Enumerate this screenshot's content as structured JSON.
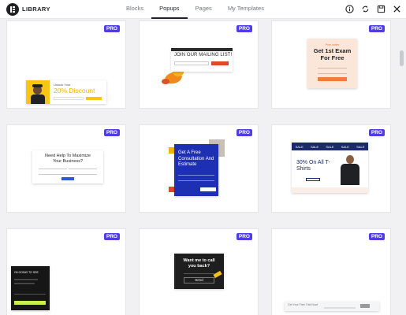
{
  "header": {
    "brand": "LIBRARY",
    "tabs": [
      {
        "label": "Blocks"
      },
      {
        "label": "Popups"
      },
      {
        "label": "Pages"
      },
      {
        "label": "My Templates"
      }
    ],
    "active_tab": "Popups",
    "icons": [
      "info-icon",
      "sync-icon",
      "save-icon",
      "close-icon"
    ]
  },
  "badge_label": "PRO",
  "cards": [
    {
      "title_small": "Unlock Your",
      "title_big": "20% Discount"
    },
    {
      "title": "JOIN OUR MAILING LIST!"
    },
    {
      "kicker": "Prep better",
      "title": "Get 1st Exam For Free"
    },
    {
      "title": "Need Help To Maximize Your Business?"
    },
    {
      "title": "Get A Free Consultation And Estimate"
    },
    {
      "sale_labels": [
        "SALE",
        "SALE",
        "SALE",
        "SALE",
        "SALE"
      ],
      "title": "30% On All T-Shirts"
    },
    {
      "title": "I'M GOING TO SEE"
    },
    {
      "title": "Want me to call you back?",
      "button": "Send"
    },
    {
      "title": "Get Your Free Trial Now!"
    }
  ],
  "colors": {
    "badge": "#4f3ee8",
    "consult_blue": "#1d2fb3",
    "sale_navy": "#1b2a6b",
    "exam_orange": "#f07d3a",
    "discount_yellow": "#f7c614"
  }
}
